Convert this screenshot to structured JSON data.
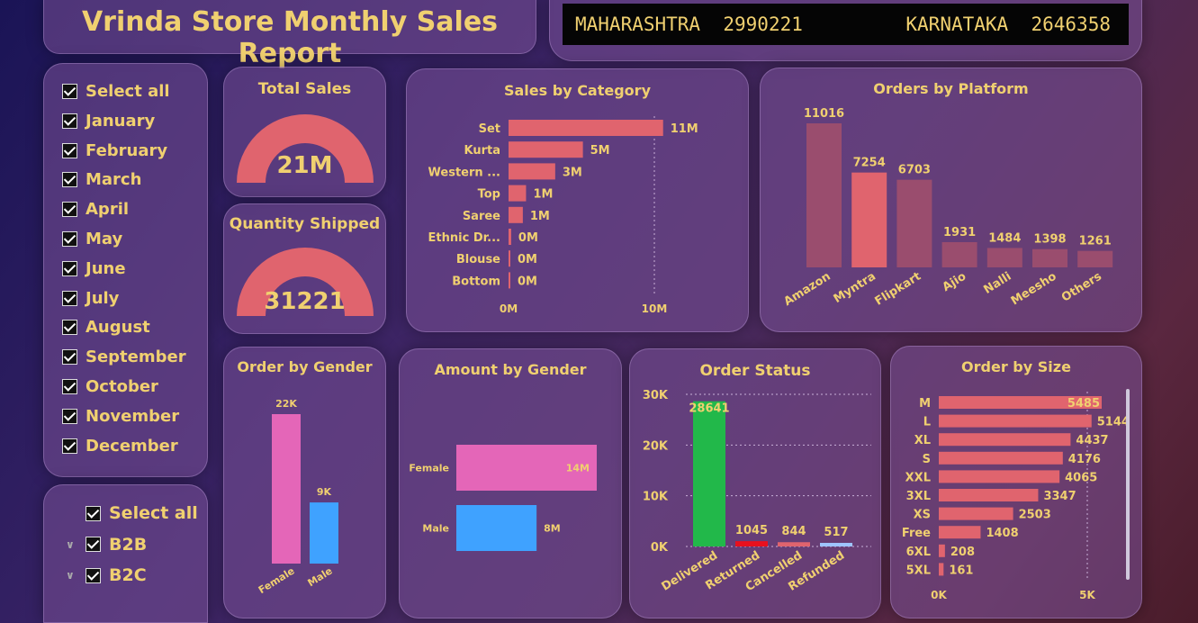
{
  "header": {
    "title": "Vrinda Store Monthly Sales Report"
  },
  "ticker": [
    {
      "state": "MAHARASHTRA",
      "value": "2990221"
    },
    {
      "state": "KARNATAKA",
      "value": "2646358"
    }
  ],
  "month_slicer": {
    "items": [
      "Select all",
      "January",
      "February",
      "March",
      "April",
      "May",
      "June",
      "July",
      "August",
      "September",
      "October",
      "November",
      "December"
    ]
  },
  "channel_slicer": {
    "items": [
      {
        "label": "Select all",
        "expandable": false
      },
      {
        "label": "B2B",
        "expandable": true
      },
      {
        "label": "B2C",
        "expandable": true
      }
    ]
  },
  "kpi": {
    "total_sales": {
      "title": "Total Sales",
      "value": "21M",
      "fill": 1.0
    },
    "quantity": {
      "title": "Quantity Shipped",
      "value": "31221",
      "fill": 1.0
    }
  },
  "colors": {
    "accent": "#f0d070",
    "bar_red": "#e0646e",
    "bar_dim": "#9a4d6e",
    "female": "#e466b8",
    "male": "#3fa2ff",
    "delivered": "#22b84a",
    "returned": "#e8101e",
    "refunded": "#9ec4ff"
  },
  "charts": {
    "category": {
      "title": "Sales by Category",
      "chart_data": {
        "type": "bar",
        "orientation": "horizontal",
        "categories": [
          "Set",
          "Kurta",
          "Western ...",
          "Top",
          "Saree",
          "Ethnic Dr...",
          "Blouse",
          "Bottom"
        ],
        "values": [
          10.6,
          5.1,
          3.2,
          1.2,
          0.98,
          0.18,
          0.11,
          0.08
        ],
        "labels": [
          "11M",
          "5M",
          "3M",
          "1M",
          "1M",
          "0M",
          "0M",
          "0M"
        ],
        "xticks": [
          "0M",
          "10M"
        ],
        "xlim": [
          0,
          10
        ]
      }
    },
    "platform": {
      "title": "Orders by Platform",
      "chart_data": {
        "type": "bar",
        "categories": [
          "Amazon",
          "Myntra",
          "Flipkart",
          "Ajio",
          "Nalli",
          "Meesho",
          "Others"
        ],
        "values": [
          11016,
          7254,
          6703,
          1931,
          1484,
          1398,
          1261
        ],
        "highlight": 1
      }
    },
    "gender_orders": {
      "title": "Order by Gender",
      "chart_data": {
        "type": "bar",
        "categories": [
          "Female",
          "Male"
        ],
        "values": [
          22,
          9
        ],
        "labels": [
          "22K",
          "9K"
        ]
      }
    },
    "gender_amount": {
      "title": "Amount by Gender",
      "chart_data": {
        "type": "bar",
        "orientation": "horizontal",
        "categories": [
          "Female",
          "Male"
        ],
        "values": [
          14,
          8
        ],
        "labels": [
          "14M",
          "8M"
        ]
      }
    },
    "status": {
      "title": "Order Status",
      "chart_data": {
        "type": "bar",
        "categories": [
          "Delivered",
          "Returned",
          "Cancelled",
          "Refunded"
        ],
        "values": [
          28641,
          1045,
          844,
          517
        ],
        "yticks": [
          "0K",
          "10K",
          "20K",
          "30K"
        ],
        "ylim": [
          0,
          30000
        ]
      }
    },
    "size": {
      "title": "Order by Size",
      "chart_data": {
        "type": "bar",
        "orientation": "horizontal",
        "categories": [
          "M",
          "L",
          "XL",
          "S",
          "XXL",
          "3XL",
          "XS",
          "Free",
          "6XL",
          "5XL"
        ],
        "values": [
          5485,
          5144,
          4437,
          4176,
          4065,
          3347,
          2503,
          1408,
          208,
          161
        ],
        "xticks": [
          "0K",
          "5K"
        ],
        "xlim": [
          0,
          5000
        ]
      }
    }
  }
}
